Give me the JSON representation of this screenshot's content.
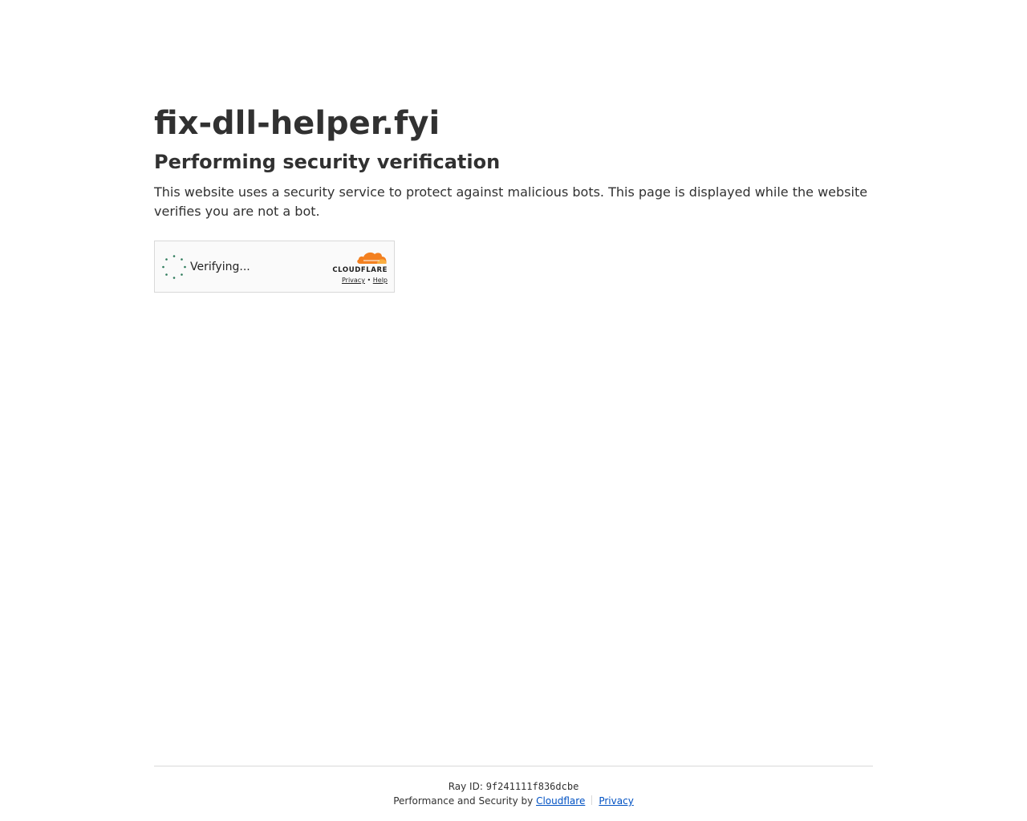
{
  "main": {
    "site_title": "fix-dll-helper.fyi",
    "heading": "Performing security verification",
    "description": "This website uses a security service to protect against malicious bots. This page is displayed while the website verifies you are not a bot."
  },
  "widget": {
    "status": "Verifying...",
    "brand": "CLOUDFLARE",
    "privacy_link": "Privacy",
    "separator": "•",
    "help_link": "Help",
    "spinner_color": "#2c7a5a",
    "logo_color": "#f38020"
  },
  "footer": {
    "ray_label": "Ray ID:",
    "ray_id": "9f241111f836dcbe",
    "perf_text": "Performance and Security by",
    "cloudflare_link": "Cloudflare",
    "privacy_link": "Privacy"
  }
}
